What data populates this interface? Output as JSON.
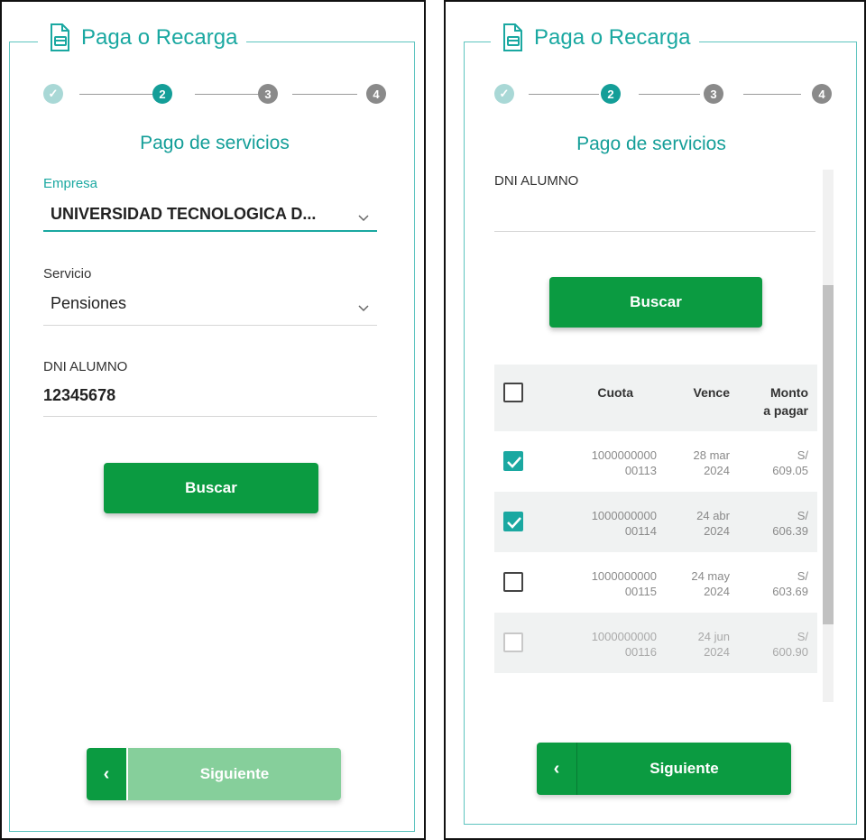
{
  "left": {
    "title": "Paga o Recarga",
    "steps": [
      "✓",
      "2",
      "3",
      "4"
    ],
    "subtitle": "Pago de servicios",
    "empresa_label": "Empresa",
    "empresa_value": "UNIVERSIDAD TECNOLOGICA D...",
    "servicio_label": "Servicio",
    "servicio_value": "Pensiones",
    "dni_label": "DNI ALUMNO",
    "dni_value": "12345678",
    "search_label": "Buscar",
    "back_glyph": "‹",
    "next_label": "Siguiente"
  },
  "right": {
    "title": "Paga o Recarga",
    "steps": [
      "✓",
      "2",
      "3",
      "4"
    ],
    "subtitle": "Pago de servicios",
    "dni_label": "DNI ALUMNO",
    "search_label": "Buscar",
    "table": {
      "headers": {
        "cuota": "Cuota",
        "vence": "Vence",
        "monto": "Monto\na pagar"
      },
      "rows": [
        {
          "cuota": "1000000000\n00113",
          "vence": "28 mar\n2024",
          "monto": "S/\n609.05",
          "checked": true,
          "enabled": true
        },
        {
          "cuota": "1000000000\n00114",
          "vence": "24 abr\n2024",
          "monto": "S/\n606.39",
          "checked": true,
          "enabled": true
        },
        {
          "cuota": "1000000000\n00115",
          "vence": "24 may\n2024",
          "monto": "S/\n603.69",
          "checked": false,
          "enabled": true
        },
        {
          "cuota": "1000000000\n00116",
          "vence": "24 jun\n2024",
          "monto": "S/\n600.90",
          "checked": false,
          "enabled": false
        }
      ]
    },
    "back_glyph": "‹",
    "next_label": "Siguiente"
  },
  "colors": {
    "teal": "#1aa8a1",
    "green": "#0b9b41",
    "green_disabled": "#86cf9b",
    "step_done": "#a9d8d6",
    "step_todo": "#8a8a8a"
  },
  "icons": [
    "document-card-icon",
    "chevron-down-icon",
    "check-icon",
    "chevron-left-icon"
  ]
}
